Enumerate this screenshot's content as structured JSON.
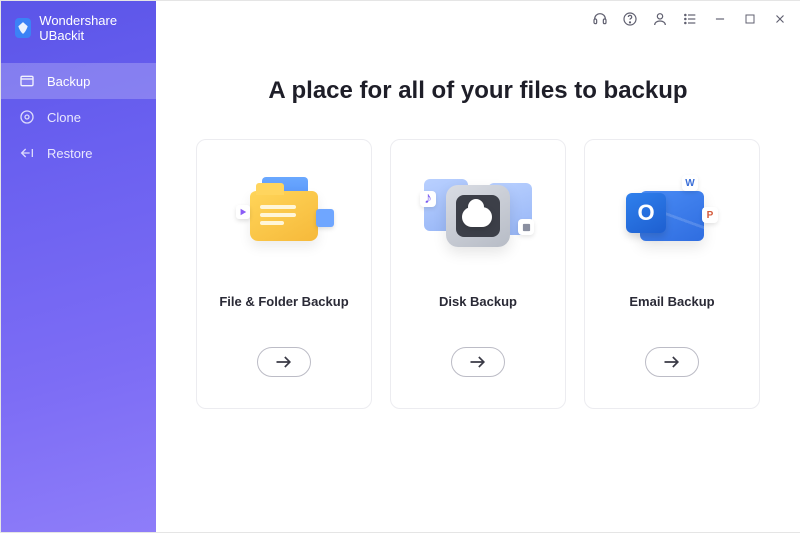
{
  "app": {
    "name": "Wondershare UBackit"
  },
  "sidebar": {
    "items": [
      {
        "label": "Backup",
        "icon": "backup-icon",
        "active": true
      },
      {
        "label": "Clone",
        "icon": "clone-icon",
        "active": false
      },
      {
        "label": "Restore",
        "icon": "restore-icon",
        "active": false
      }
    ]
  },
  "titlebar": {
    "icons": [
      "support-icon",
      "help-icon",
      "account-icon",
      "menu-icon",
      "minimize-icon",
      "maximize-icon",
      "close-icon"
    ]
  },
  "main": {
    "headline": "A place for all of your files to backup",
    "cards": [
      {
        "title": "File & Folder Backup",
        "icon": "folder-illustration"
      },
      {
        "title": "Disk Backup",
        "icon": "disk-illustration"
      },
      {
        "title": "Email Backup",
        "icon": "email-illustration"
      }
    ]
  },
  "colors": {
    "sidebar_gradient_from": "#5b55e8",
    "sidebar_gradient_to": "#8e7df9",
    "card_border": "#ececf0"
  }
}
